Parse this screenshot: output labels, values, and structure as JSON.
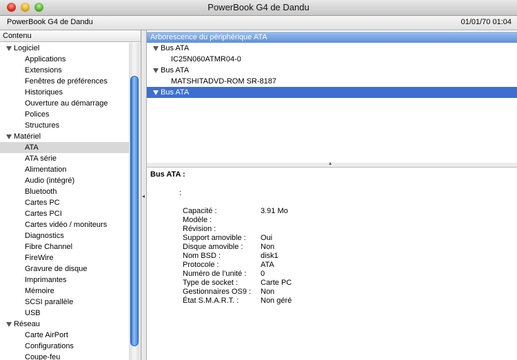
{
  "window": {
    "title": "PowerBook G4 de Dandu"
  },
  "infobar": {
    "machine": "PowerBook G4 de Dandu",
    "date": "01/01/70 01:04"
  },
  "sidebar": {
    "header": "Contenu",
    "groups": [
      {
        "label": "Logiciel",
        "items": [
          "Applications",
          "Extensions",
          "Fenêtres de préférences",
          "Historiques",
          "Ouverture au démarrage",
          "Polices",
          "Structures"
        ]
      },
      {
        "label": "Matériel",
        "items": [
          "ATA",
          "ATA série",
          "Alimentation",
          "Audio (intégré)",
          "Bluetooth",
          "Cartes PC",
          "Cartes PCI",
          "Cartes vidéo / moniteurs",
          "Diagnostics",
          "Fibre Channel",
          "FireWire",
          "Gravure de disque",
          "Imprimantes",
          "Mémoire",
          "SCSI parallèle",
          "USB"
        ]
      },
      {
        "label": "Réseau",
        "items": [
          "Carte AirPort",
          "Configurations",
          "Coupe-feu"
        ]
      }
    ],
    "selected": "ATA"
  },
  "device_tree": {
    "header": "Arborescence du périphérique ATA",
    "nodes": [
      {
        "label": "Bus ATA",
        "child": "IC25N060ATMR04-0"
      },
      {
        "label": "Bus ATA",
        "child": "MATSHITADVD-ROM SR-8187"
      },
      {
        "label": "Bus ATA",
        "child": ""
      }
    ],
    "selected_index": 2
  },
  "details": {
    "title": "Bus ATA :",
    "subtitle": ":",
    "properties": [
      {
        "key": "Capacité :",
        "value": "3.91 Mo"
      },
      {
        "key": "Modèle :",
        "value": ""
      },
      {
        "key": "Révision :",
        "value": ""
      },
      {
        "key": "Support amovible :",
        "value": "Oui"
      },
      {
        "key": "Disque amovible :",
        "value": "Non"
      },
      {
        "key": "Nom BSD :",
        "value": "disk1"
      },
      {
        "key": "Protocole :",
        "value": "ATA"
      },
      {
        "key": "Numéro de l’unité :",
        "value": "0"
      },
      {
        "key": "Type de socket :",
        "value": "Carte PC"
      },
      {
        "key": "Gestionnaires OS9 :",
        "value": "Non"
      },
      {
        "key": "État S.M.A.R.T. :",
        "value": "Non géré"
      }
    ]
  }
}
